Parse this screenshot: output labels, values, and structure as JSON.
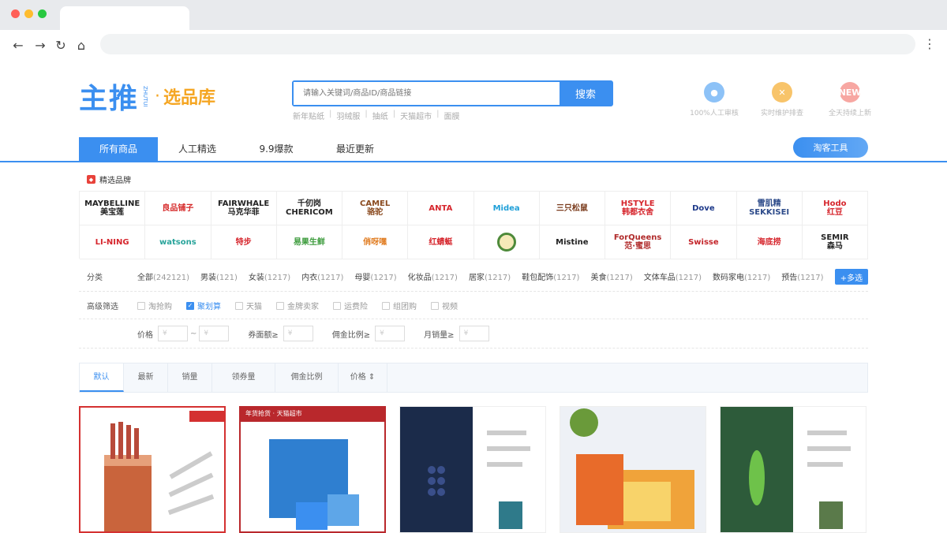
{
  "search": {
    "placeholder": "请输入关键词/商品ID/商品链接",
    "button": "搜索",
    "hot_words": [
      "新年贴纸",
      "羽绒服",
      "抽纸",
      "天猫超市",
      "面膜"
    ]
  },
  "logo": {
    "main": "主推",
    "sub": "ZHUTUI",
    "dot": "·",
    "tag": "选品库"
  },
  "features": [
    {
      "label": "100%人工审核",
      "icon": "person-icon",
      "color": "#8dc2f7"
    },
    {
      "label": "实时维护排查",
      "icon": "tools-icon",
      "color": "#f8c46a"
    },
    {
      "label": "全天持续上新",
      "icon": "new-badge-icon",
      "color": "#f7a7a2",
      "text": "NEW"
    }
  ],
  "tabs": [
    "所有商品",
    "人工精选",
    "9.9爆款",
    "最近更新"
  ],
  "taoke_button": "淘客工具",
  "brand_title": "精选品牌",
  "brands": [
    {
      "name": "MAYBELLINE\n美宝莲",
      "color": "#222222"
    },
    {
      "name": "良品铺子",
      "color": "#d62b2b"
    },
    {
      "name": "FAIRWHALE\n马克华菲",
      "color": "#222222"
    },
    {
      "name": "千仞岗\nCHERICOM",
      "color": "#222222"
    },
    {
      "name": "CAMEL\n骆驼",
      "color": "#8a4a1f"
    },
    {
      "name": "ANTA",
      "color": "#d6262d"
    },
    {
      "name": "Midea",
      "color": "#1e9fd8"
    },
    {
      "name": "三只松鼠",
      "color": "#7a3b1c"
    },
    {
      "name": "HSTYLE\n韩都衣舍",
      "color": "#d6262d"
    },
    {
      "name": "Dove",
      "color": "#1e3a8a"
    },
    {
      "name": "雪肌精\nSEKKISEI",
      "color": "#2d4b8a"
    },
    {
      "name": "Hodo\n红豆",
      "color": "#d6262d"
    },
    {
      "name": "LI-NING",
      "color": "#d6262d"
    },
    {
      "name": "watsons",
      "color": "#27a39a"
    },
    {
      "name": "特步",
      "color": "#d6262d"
    },
    {
      "name": "易果生鲜",
      "color": "#3a9a3a"
    },
    {
      "name": "俏呀嘿",
      "color": "#e07b1f"
    },
    {
      "name": "红蜻蜓",
      "color": "#d6262d"
    },
    {
      "name": "",
      "color": "#4e8a3a"
    },
    {
      "name": "Mistine",
      "color": "#222222"
    },
    {
      "name": "ForQueens\n范·蜜思",
      "color": "#b02a2a"
    },
    {
      "name": "Swisse",
      "color": "#c4252a"
    },
    {
      "name": "海底捞",
      "color": "#d6262d"
    },
    {
      "name": "SEMIR\n森马",
      "color": "#222222"
    }
  ],
  "category_label": "分类",
  "categories": [
    {
      "name": "全部",
      "count": "(242121)"
    },
    {
      "name": "男装",
      "count": "(121)"
    },
    {
      "name": "女装",
      "count": "(1217)"
    },
    {
      "name": "内衣",
      "count": "(1217)"
    },
    {
      "name": "母婴",
      "count": "(1217)"
    },
    {
      "name": "化妆品",
      "count": "(1217)"
    },
    {
      "name": "居家",
      "count": "(1217)"
    },
    {
      "name": "鞋包配饰",
      "count": "(1217)"
    },
    {
      "name": "美食",
      "count": "(1217)"
    },
    {
      "name": "文体车品",
      "count": "(1217)"
    },
    {
      "name": "数码家电",
      "count": "(1217)"
    },
    {
      "name": "预告",
      "count": "(1217)"
    }
  ],
  "multi_select": "+多选",
  "advanced_label": "高级筛选",
  "advanced_options": [
    {
      "label": "淘抢购",
      "checked": false
    },
    {
      "label": "聚划算",
      "checked": true
    },
    {
      "label": "天猫",
      "checked": false
    },
    {
      "label": "金牌卖家",
      "checked": false
    },
    {
      "label": "运费险",
      "checked": false
    },
    {
      "label": "组团购",
      "checked": false
    },
    {
      "label": "视频",
      "checked": false
    }
  ],
  "ranges": [
    {
      "label": "价格",
      "placeholder_min": "¥",
      "placeholder_max": "¥",
      "dual": true
    },
    {
      "label": "券面额≥",
      "placeholder_min": "¥",
      "dual": false
    },
    {
      "label": "佣金比例≥",
      "placeholder_min": "¥",
      "dual": false
    },
    {
      "label": "月销量≥",
      "placeholder_min": "¥",
      "dual": false
    }
  ],
  "range_sep": "~",
  "sorts": [
    "默认",
    "最新",
    "销量",
    "领券量",
    "佣金比例",
    "价格 ⇕"
  ],
  "products": [
    {
      "banner": "",
      "color": "#d43131"
    },
    {
      "banner": "年货抢货 · 天猫超市",
      "color": "#b9282c"
    },
    {
      "banner": "",
      "color": "#1b2b4a"
    },
    {
      "banner": "",
      "color": "#f0a33a"
    },
    {
      "banner": "",
      "color": "#2d5b3a"
    }
  ]
}
